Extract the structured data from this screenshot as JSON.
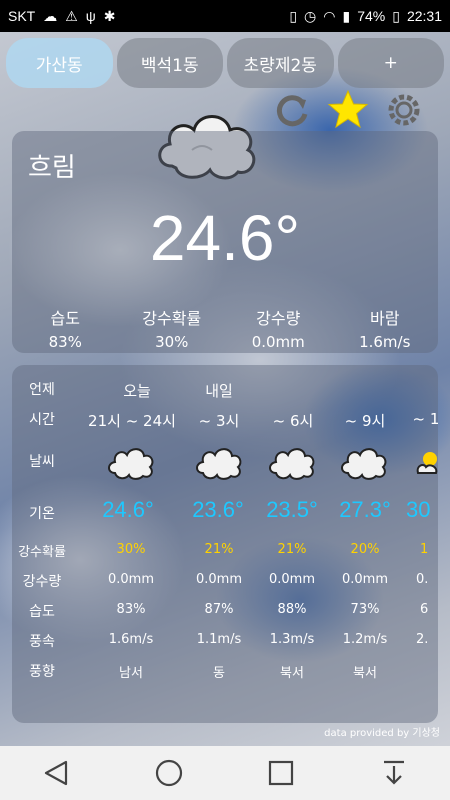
{
  "status_bar": {
    "carrier": "SKT",
    "battery": "74%",
    "time": "22:31",
    "icons": [
      "cloud-icon",
      "warning-icon",
      "usb-icon",
      "android-debug-icon",
      "vibrate-icon",
      "alarm-icon",
      "wifi-icon",
      "signal-icon",
      "battery-icon"
    ]
  },
  "tabs": [
    {
      "label": "가산동",
      "active": true
    },
    {
      "label": "백석1동",
      "active": false
    },
    {
      "label": "초량제2동",
      "active": false
    },
    {
      "label": "+",
      "active": false
    }
  ],
  "toolbar_icons": [
    "refresh-icon",
    "star-icon",
    "settings-icon"
  ],
  "current": {
    "condition": "흐림",
    "temperature": "24.6°",
    "stats": [
      {
        "label": "습도",
        "value": "83%"
      },
      {
        "label": "강수확률",
        "value": "30%"
      },
      {
        "label": "강수량",
        "value": "0.0mm"
      },
      {
        "label": "바람",
        "value": "1.6m/s"
      }
    ]
  },
  "forecast": {
    "labels": {
      "day": "언제",
      "time": "시간",
      "weather": "날씨",
      "temp": "기온",
      "pop": "강수확률",
      "rain": "강수량",
      "humidity": "습도",
      "wind_speed": "풍속",
      "wind_dir": "풍향"
    },
    "day_headers": [
      "오늘",
      "내일"
    ],
    "columns": [
      {
        "time": "21시 ~ 24시",
        "temp": "24.6°",
        "pop": "30%",
        "rain": "0.0mm",
        "humidity": "83%",
        "wind_speed": "1.6m/s",
        "wind_dir": "남서"
      },
      {
        "time": "~ 3시",
        "temp": "23.6°",
        "pop": "21%",
        "rain": "0.0mm",
        "humidity": "87%",
        "wind_speed": "1.1m/s",
        "wind_dir": "동"
      },
      {
        "time": "~ 6시",
        "temp": "23.5°",
        "pop": "21%",
        "rain": "0.0mm",
        "humidity": "88%",
        "wind_speed": "1.3m/s",
        "wind_dir": "북서"
      },
      {
        "time": "~ 9시",
        "temp": "27.3°",
        "pop": "20%",
        "rain": "0.0mm",
        "humidity": "73%",
        "wind_speed": "1.2m/s",
        "wind_dir": "북서"
      },
      {
        "time": "~ 1",
        "temp": "30",
        "pop": "1",
        "rain": "0.",
        "humidity": "6",
        "wind_speed": "2.",
        "wind_dir": ""
      }
    ]
  },
  "credit": "data provided by 기상청",
  "nav": [
    "back-icon",
    "home-icon",
    "recents-icon",
    "notification-pull-icon"
  ]
}
